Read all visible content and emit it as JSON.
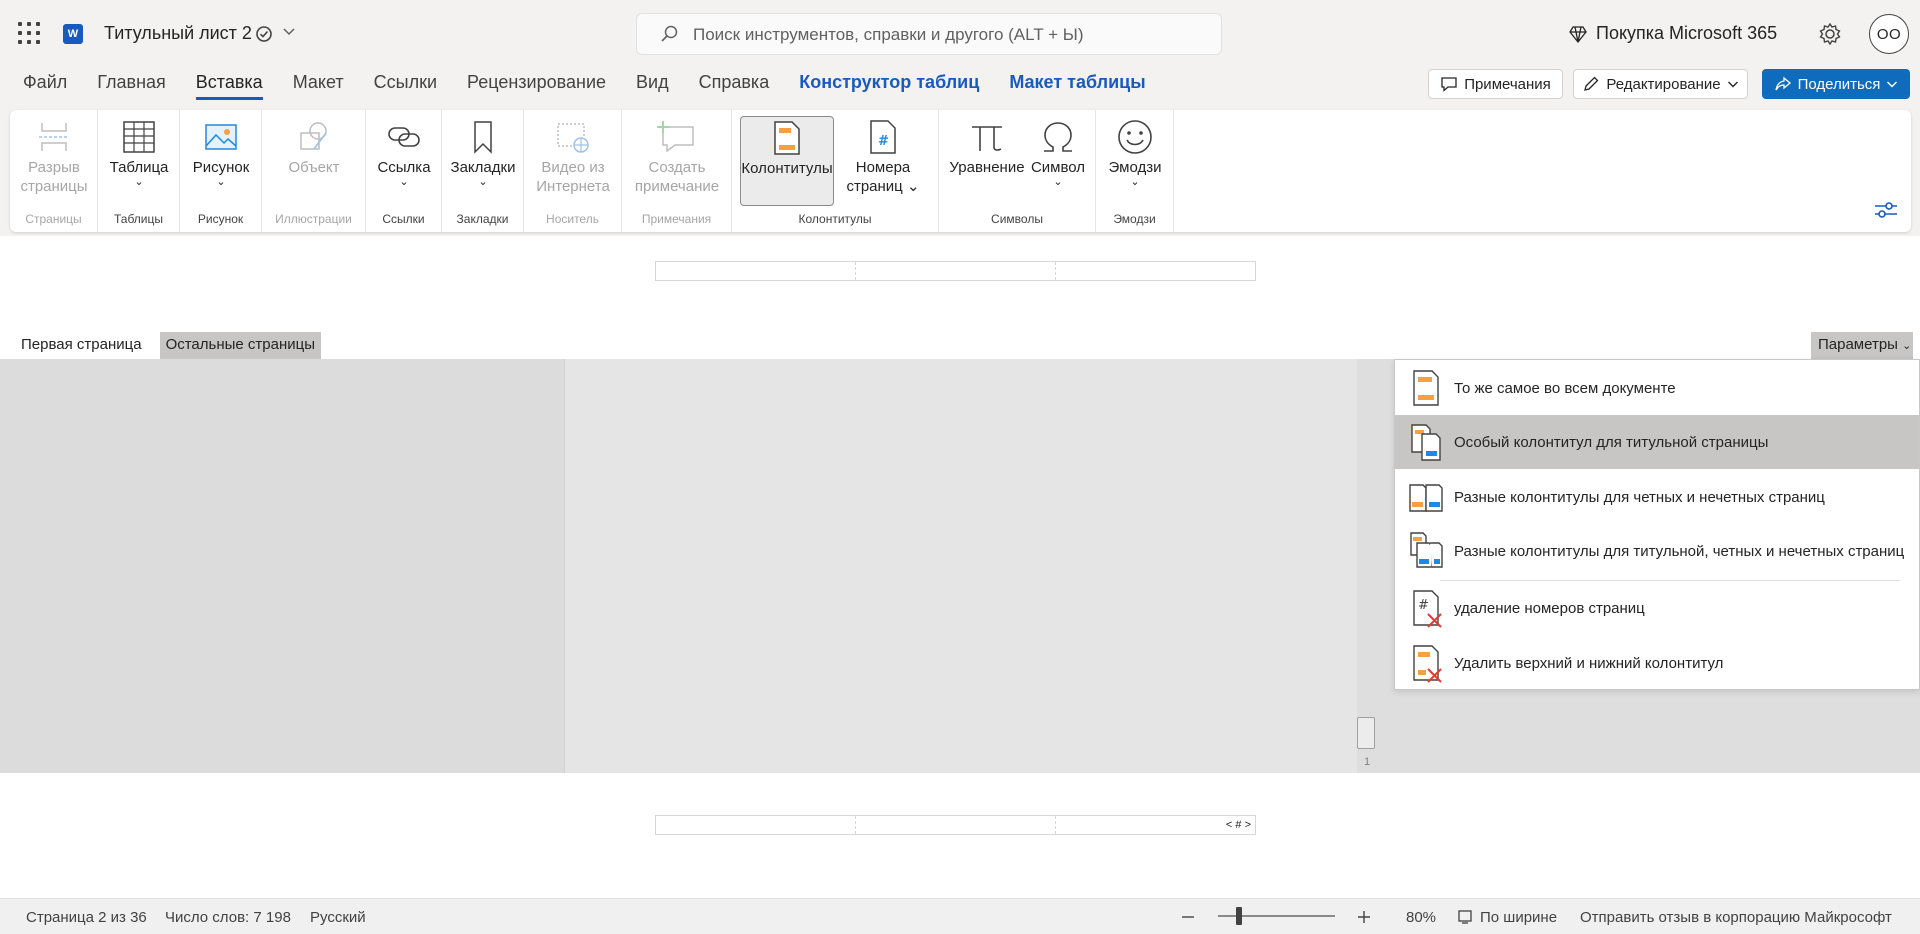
{
  "app": {
    "doc_title": "Титульный лист 2",
    "search_placeholder": "Поиск инструментов, справки и другого (ALT + Ы)",
    "premium_label": "Покупка Microsoft 365",
    "avatar_initials": "OO",
    "logo_letter": "W"
  },
  "menu": {
    "tabs": [
      "Файл",
      "Главная",
      "Вставка",
      "Макет",
      "Ссылки",
      "Рецензирование",
      "Вид",
      "Справка",
      "Конструктор таблиц",
      "Макет таблицы"
    ],
    "active_tab": "Вставка",
    "comments_label": "Примечания",
    "editing_label": "Редактирование",
    "share_label": "Поделиться"
  },
  "ribbon": {
    "page_break": {
      "line1": "Разрыв",
      "line2": "страницы",
      "group": "Страницы"
    },
    "table": {
      "label": "Таблица",
      "group": "Таблицы"
    },
    "picture": {
      "label": "Рисунок",
      "group": "Рисунок"
    },
    "object": {
      "label": "Объект",
      "group": "Иллюстрации"
    },
    "link": {
      "label": "Ссылка",
      "group": "Ссылки"
    },
    "bookmarks": {
      "label": "Закладки",
      "group": "Закладки"
    },
    "video": {
      "line1": "Видео из",
      "line2": "Интернета",
      "group": "Носитель"
    },
    "comment": {
      "line1": "Создать",
      "line2": "примечание",
      "group": "Примечания"
    },
    "headers": {
      "label": "Колонтитулы",
      "group": "Колонтитулы"
    },
    "page_numbers": {
      "line1": "Номера",
      "line2": "страниц"
    },
    "equation": {
      "label": "Уравнение"
    },
    "symbol": {
      "label": "Символ",
      "group": "Символы"
    },
    "emoji": {
      "label": "Эмодзи",
      "group": "Эмодзи"
    }
  },
  "document": {
    "first_page_tab": "Первая страница",
    "other_pages_tab": "Остальные страницы",
    "params_label": "Параметры",
    "page_field": "< # >",
    "page_thumb_number": "1"
  },
  "dropdown": {
    "items": [
      {
        "label": "То же самое во всем документе",
        "icon": "same-header-icon"
      },
      {
        "label": "Особый колонтитул для титульной страницы",
        "icon": "title-page-header-icon"
      },
      {
        "label": "Разные колонтитулы для четных и нечетных страниц",
        "icon": "odd-even-header-icon"
      },
      {
        "label": "Разные колонтитулы для титульной, четных и нечетных страниц",
        "icon": "title-odd-even-header-icon"
      },
      {
        "label": "удаление номеров страниц",
        "icon": "remove-page-numbers-icon"
      },
      {
        "label": "Удалить верхний и нижний колонтитул",
        "icon": "remove-header-footer-icon"
      }
    ],
    "highlighted_index": 1
  },
  "status": {
    "page": "Страница 2 из 36",
    "words": "Число слов: 7 198",
    "language": "Русский",
    "zoom": "80%",
    "fit_width": "По ширине",
    "feedback": "Отправить отзыв в корпорацию Майкрософт"
  },
  "colors": {
    "accent": "#185abd",
    "share_button": "#0f6cbd",
    "highlight": "#c8c6c4",
    "icon_orange": "#f5a142",
    "icon_blue": "#1e88e5",
    "delete_red": "#e53935"
  }
}
